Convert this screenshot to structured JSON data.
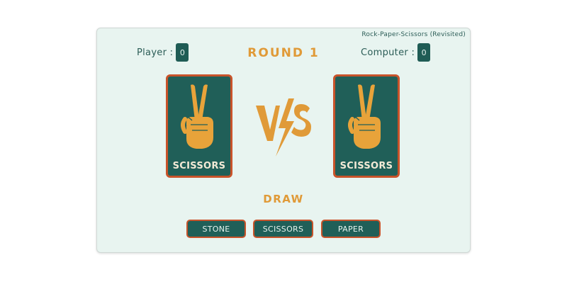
{
  "header": {
    "subtitle": "Rock-Paper-Scissors (Revisited)",
    "round": "ROUND 1"
  },
  "player": {
    "label": "Player :",
    "score": "0"
  },
  "computer": {
    "label": "Computer :",
    "score": "0"
  },
  "cards": {
    "player": {
      "choice": "SCISSORS",
      "icon": "peace-hand-icon"
    },
    "computer": {
      "choice": "SCISSORS",
      "icon": "peace-hand-icon"
    }
  },
  "vs_icon": "vs-lightning-icon",
  "result": "DRAW",
  "buttons": {
    "stone": "STONE",
    "scissors": "SCISSORS",
    "paper": "PAPER"
  },
  "colors": {
    "background": "#e8f4f0",
    "teal": "#205f58",
    "orange": "#e09a38",
    "border_red": "#c8532a"
  }
}
